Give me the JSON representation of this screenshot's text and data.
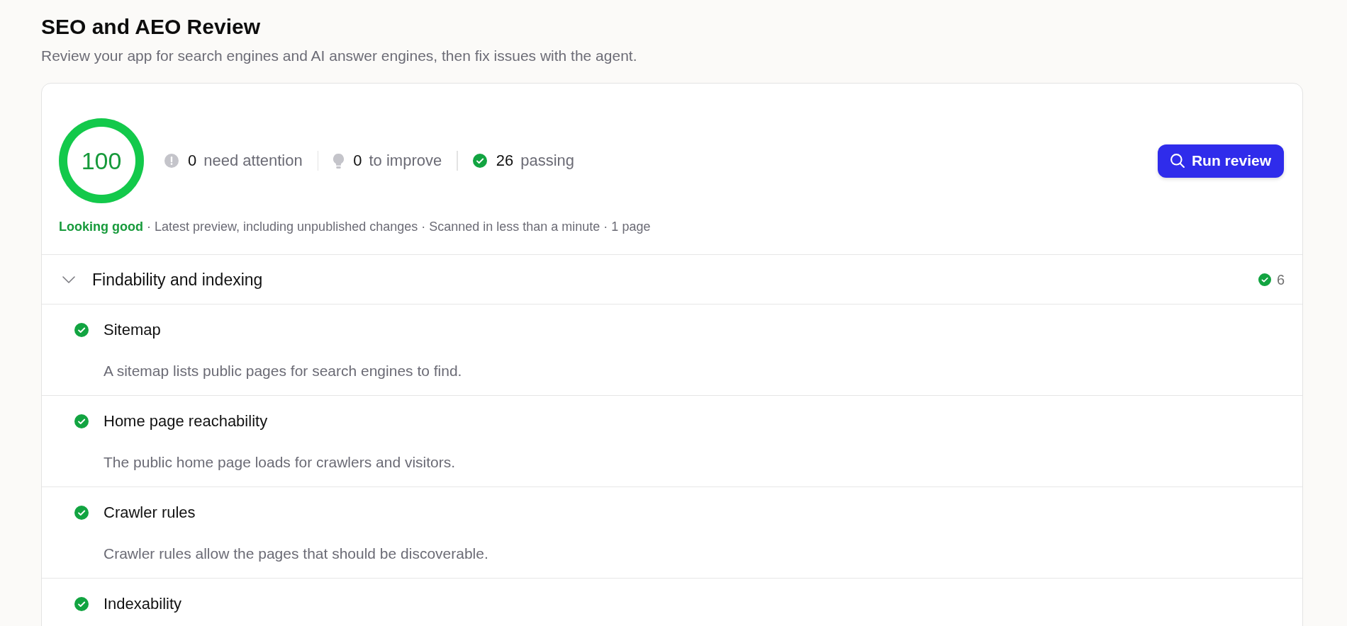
{
  "header": {
    "title": "SEO and AEO Review",
    "subtitle": "Review your app for search engines and AI answer engines, then fix issues with the agent."
  },
  "summary": {
    "score": "100",
    "level": 1,
    "stats": [
      {
        "kind": "attention",
        "count": "0",
        "label": "need attention"
      },
      {
        "kind": "improve",
        "count": "0",
        "label": "to improve"
      },
      {
        "kind": "passing",
        "count": "26",
        "label": "passing"
      }
    ],
    "button": "Run review",
    "status": "Looking good",
    "details": "· Latest preview, including unpublished changes · Scanned in less than a minute · 1 page"
  },
  "sections": [
    {
      "title": "Findability and indexing",
      "expanded": true,
      "passed": true,
      "count": "6",
      "checks": [
        {
          "title": "Sitemap",
          "passed": true,
          "description": "A sitemap lists public pages for search engines to find."
        },
        {
          "title": "Home page reachability",
          "passed": true,
          "description": "The public home page loads for crawlers and visitors."
        },
        {
          "title": "Crawler rules",
          "passed": true,
          "description": "Crawler rules allow the pages that should be discoverable."
        },
        {
          "title": "Indexability",
          "passed": true
        }
      ]
    }
  ]
}
